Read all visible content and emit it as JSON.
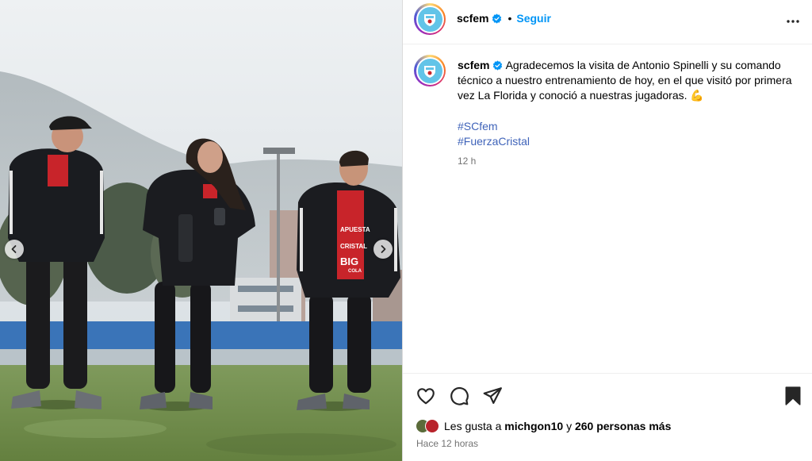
{
  "post": {
    "username": "scfem",
    "separator": "•",
    "follow_label": "Seguir",
    "caption": "Agradecemos la visita de Antonio Spinelli y su comando técnico a nuestro entrenamiento de hoy, en el que visitó por primera vez La Florida y conoció a nuestras jugadoras. 💪",
    "hashtags": [
      "#SCfem",
      "#FuerzaCristal"
    ],
    "relative_time": "12 h"
  },
  "likes": {
    "prefix": "Les gusta a",
    "first_user": "michgon10",
    "conjunction": "y",
    "others": "260 personas más"
  },
  "posted_ago": "Hace 12 horas",
  "photo": {
    "shirt_text": [
      "APUESTA",
      "CRISTAL",
      "BIG",
      "COLA"
    ]
  },
  "icons": {
    "verified": "verified-badge-icon",
    "more": "more-options-icon",
    "like": "heart-icon",
    "comment": "comment-icon",
    "share": "share-icon",
    "save": "bookmark-icon",
    "prev": "chevron-left-icon",
    "next": "chevron-right-icon"
  },
  "colors": {
    "accent": "#0095f6",
    "hashtag": "#3f63b9",
    "muted": "#737373",
    "verified": "#0095f6"
  }
}
